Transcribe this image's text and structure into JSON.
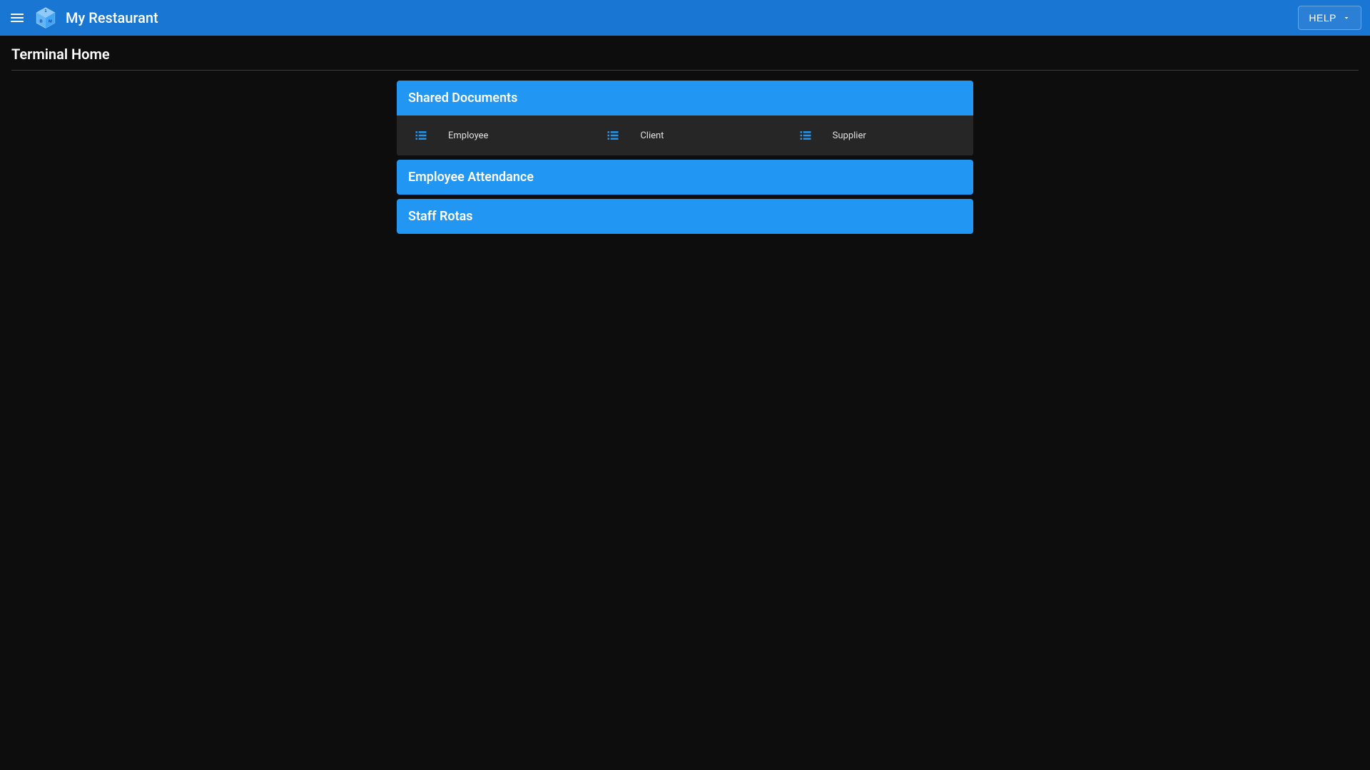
{
  "header": {
    "app_title": "My Restaurant",
    "help_label": "HELP"
  },
  "page": {
    "title": "Terminal Home"
  },
  "cards": {
    "shared_documents": {
      "title": "Shared Documents",
      "items": [
        {
          "label": "Employee"
        },
        {
          "label": "Client"
        },
        {
          "label": "Supplier"
        }
      ]
    },
    "employee_attendance": {
      "title": "Employee Attendance"
    },
    "staff_rotas": {
      "title": "Staff Rotas"
    }
  }
}
